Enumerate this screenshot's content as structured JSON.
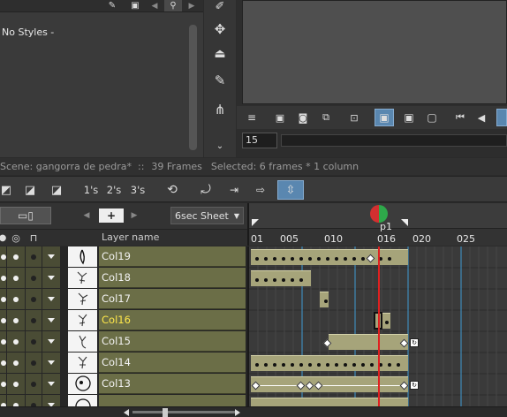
{
  "styles_panel": {
    "no_styles": "No Styles -"
  },
  "frame_field": {
    "value": "15"
  },
  "status": {
    "scene": "Scene: gangorra de pedra*",
    "sep": "::",
    "frames": "39 Frames",
    "selected": "Selected: 6 frames * 1 column"
  },
  "toolbar": {
    "step1": "1's",
    "step2": "2's",
    "step3": "3's"
  },
  "header": {
    "sheet": "6sec Sheet",
    "layer_name_label": "Layer name"
  },
  "ruler": {
    "ticks": [
      "01",
      "005",
      "010",
      "016",
      "020",
      "025"
    ],
    "playhead_label": "p1"
  },
  "layers": [
    {
      "name": "Col19",
      "current": false
    },
    {
      "name": "Col18",
      "current": false
    },
    {
      "name": "Col17",
      "current": false
    },
    {
      "name": "Col16",
      "current": true
    },
    {
      "name": "Col15",
      "current": false
    },
    {
      "name": "Col14",
      "current": false
    },
    {
      "name": "Col13",
      "current": false
    }
  ],
  "colors": {
    "layer_bg": "#6b6e47",
    "current_layer_text": "#ffe84a",
    "cell_block": "#a6a47a",
    "accent": "#5a87b0",
    "playhead": "#e02020"
  }
}
